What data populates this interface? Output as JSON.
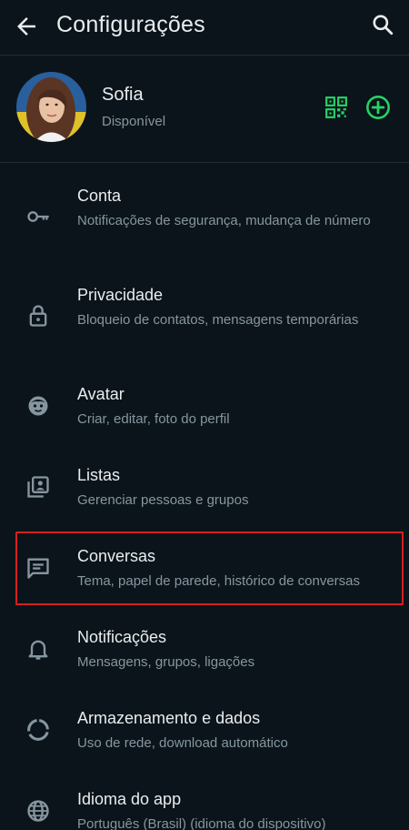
{
  "header": {
    "title": "Configurações",
    "back_icon": "arrow-left-icon",
    "search_icon": "search-icon"
  },
  "profile": {
    "name": "Sofia",
    "status": "Disponível",
    "qr_icon": "qr-code-icon",
    "add_icon": "add-circle-icon"
  },
  "colors": {
    "accent": "#25d366",
    "background": "#0b141a",
    "muted": "#8696a0",
    "highlight": "#d61f1f"
  },
  "items": [
    {
      "label": "Conta",
      "sub": "Notificações de segurança, mudança de número",
      "icon": "key-icon"
    },
    {
      "label": "Privacidade",
      "sub": "Bloqueio de contatos, mensagens temporárias",
      "icon": "lock-icon"
    },
    {
      "label": "Avatar",
      "sub": "Criar, editar, foto do perfil",
      "icon": "avatar-face-icon"
    },
    {
      "label": "Listas",
      "sub": "Gerenciar pessoas e grupos",
      "icon": "contact-list-icon"
    },
    {
      "label": "Conversas",
      "sub": "Tema, papel de parede, histórico de conversas",
      "icon": "chat-icon"
    },
    {
      "label": "Notificações",
      "sub": "Mensagens, grupos, ligações",
      "icon": "bell-icon"
    },
    {
      "label": "Armazenamento e dados",
      "sub": "Uso de rede, download automático",
      "icon": "data-usage-icon"
    },
    {
      "label": "Idioma do app",
      "sub": "Português (Brasil) (idioma do dispositivo)",
      "icon": "globe-icon"
    }
  ]
}
